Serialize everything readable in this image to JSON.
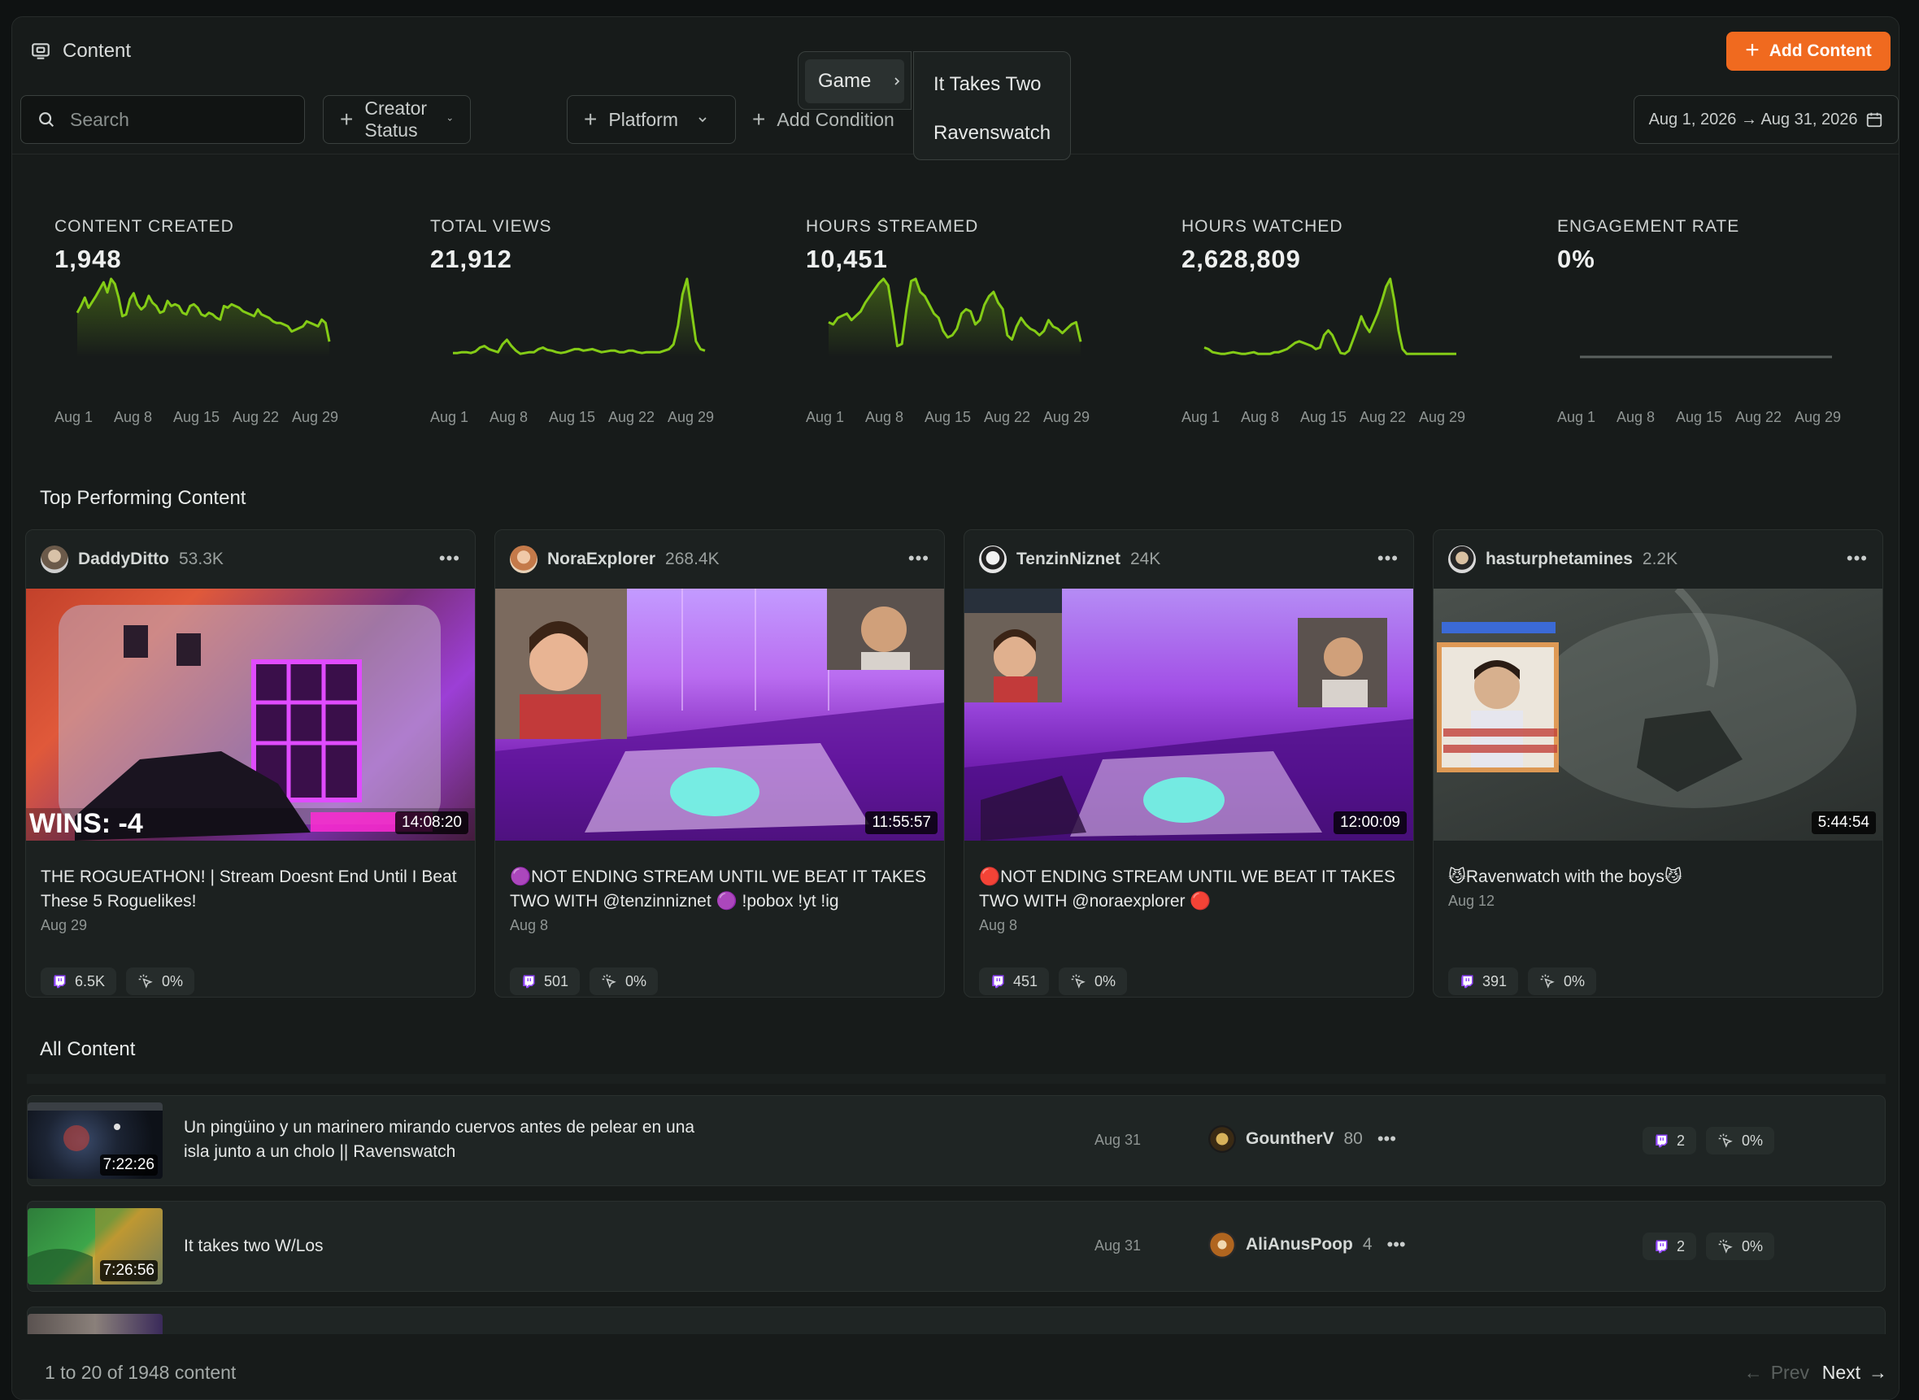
{
  "header": {
    "title": "Content",
    "add_button": "Add Content"
  },
  "filters": {
    "search_placeholder": "Search",
    "creator_status": "Creator Status",
    "platform": "Platform",
    "add_condition": "Add Condition",
    "date_range": "Aug 1, 2026 → Aug 31, 2026"
  },
  "dropdown": {
    "category": "Game",
    "options": [
      "It Takes Two",
      "Ravenswatch"
    ]
  },
  "metrics": [
    {
      "label": "CONTENT CREATED",
      "value": "1,948"
    },
    {
      "label": "TOTAL VIEWS",
      "value": "21,912"
    },
    {
      "label": "HOURS STREAMED",
      "value": "10,451"
    },
    {
      "label": "HOURS WATCHED",
      "value": "2,628,809"
    },
    {
      "label": "ENGAGEMENT RATE",
      "value": "0%"
    }
  ],
  "sparkline_ticks": [
    "Aug 1",
    "Aug 8",
    "Aug 15",
    "Aug 22",
    "Aug 29"
  ],
  "sparkline_series": [
    [
      52,
      60,
      70,
      58,
      65,
      72,
      80,
      88,
      76,
      92,
      86,
      70,
      48,
      50,
      68,
      75,
      62,
      56,
      60,
      72,
      64,
      60,
      52,
      54,
      66,
      60,
      62,
      60,
      52,
      50,
      60,
      62,
      58,
      50,
      48,
      52,
      50,
      46,
      44,
      60,
      58,
      62,
      60,
      58,
      54,
      52,
      50,
      48,
      56,
      50,
      48,
      46,
      42,
      40,
      40,
      38,
      36,
      30,
      32,
      34,
      36,
      42,
      40,
      38,
      36,
      44,
      40,
      18
    ],
    [
      5,
      5,
      6,
      6,
      5,
      7,
      12,
      14,
      10,
      8,
      6,
      16,
      22,
      14,
      8,
      4,
      5,
      6,
      6,
      10,
      12,
      9,
      8,
      6,
      5,
      6,
      8,
      10,
      10,
      8,
      9,
      10,
      8,
      6,
      7,
      8,
      8,
      6,
      6,
      8,
      8,
      6,
      5,
      6,
      6,
      6,
      6,
      8,
      10,
      16,
      40,
      80,
      100,
      60,
      20,
      10,
      8
    ],
    [
      32,
      30,
      36,
      38,
      40,
      34,
      38,
      42,
      50,
      56,
      62,
      68,
      72,
      66,
      40,
      10,
      12,
      44,
      70,
      72,
      60,
      56,
      48,
      40,
      36,
      24,
      18,
      20,
      26,
      40,
      44,
      42,
      30,
      34,
      48,
      56,
      60,
      50,
      44,
      20,
      16,
      28,
      36,
      30,
      26,
      24,
      20,
      24,
      34,
      28,
      26,
      22,
      26,
      30,
      32,
      14
    ],
    [
      12,
      10,
      6,
      5,
      4,
      4,
      5,
      6,
      5,
      4,
      4,
      5,
      6,
      4,
      4,
      4,
      4,
      6,
      6,
      8,
      10,
      14,
      18,
      20,
      18,
      16,
      14,
      10,
      12,
      28,
      34,
      28,
      16,
      5,
      4,
      8,
      22,
      36,
      52,
      40,
      32,
      44,
      56,
      72,
      90,
      100,
      72,
      34,
      10,
      4,
      4,
      4,
      4,
      4,
      4,
      4,
      4,
      4,
      4,
      4,
      4,
      4
    ],
    [
      0,
      0,
      0,
      0,
      0,
      0,
      0,
      0,
      0,
      0
    ]
  ],
  "top_performing": {
    "title": "Top Performing Content",
    "cards": [
      {
        "creator": "DaddyDitto",
        "followers": "53.3K",
        "duration": "14:08:20",
        "title": "THE ROGUEATHON! | Stream Doesnt End Until I Beat These 5 Roguelikes!",
        "date": "Aug 29",
        "views": "6.5K",
        "engagement": "0%",
        "overlay_text": "WINS:  -4"
      },
      {
        "creator": "NoraExplorer",
        "followers": "268.4K",
        "duration": "11:55:57",
        "title": "🟣NOT ENDING STREAM UNTIL WE BEAT IT TAKES TWO WITH @tenzinniznet 🟣 !pobox !yt !ig",
        "date": "Aug 8",
        "views": "501",
        "engagement": "0%"
      },
      {
        "creator": "TenzinNiznet",
        "followers": "24K",
        "duration": "12:00:09",
        "title": "🔴NOT ENDING STREAM UNTIL WE BEAT IT TAKES TWO WITH @noraexplorer 🔴",
        "date": "Aug 8",
        "views": "451",
        "engagement": "0%"
      },
      {
        "creator": "hasturphetamines",
        "followers": "2.2K",
        "duration": "5:44:54",
        "title": "😼Ravenwatch with the boys😼",
        "date": "Aug 12",
        "views": "391",
        "engagement": "0%"
      }
    ]
  },
  "all_content": {
    "title": "All Content",
    "rows": [
      {
        "title": "Un pingüino y un marinero mirando cuervos antes de pelear en una isla junto a un cholo || Ravenswatch",
        "duration": "7:22:26",
        "date": "Aug 31",
        "creator": "GountherV",
        "followers": "80",
        "views": "2",
        "engagement": "0%"
      },
      {
        "title": "It takes two W/Los",
        "duration": "7:26:56",
        "date": "Aug 31",
        "creator": "AliAnusPoop",
        "followers": "4",
        "views": "2",
        "engagement": "0%"
      }
    ]
  },
  "footer": {
    "count": "1 to 20 of 1948 content",
    "prev": "Prev",
    "next": "Next"
  },
  "colors": {
    "accent": "#f06a1f",
    "spark": "#84cc16",
    "twitch": "#9146ff"
  }
}
